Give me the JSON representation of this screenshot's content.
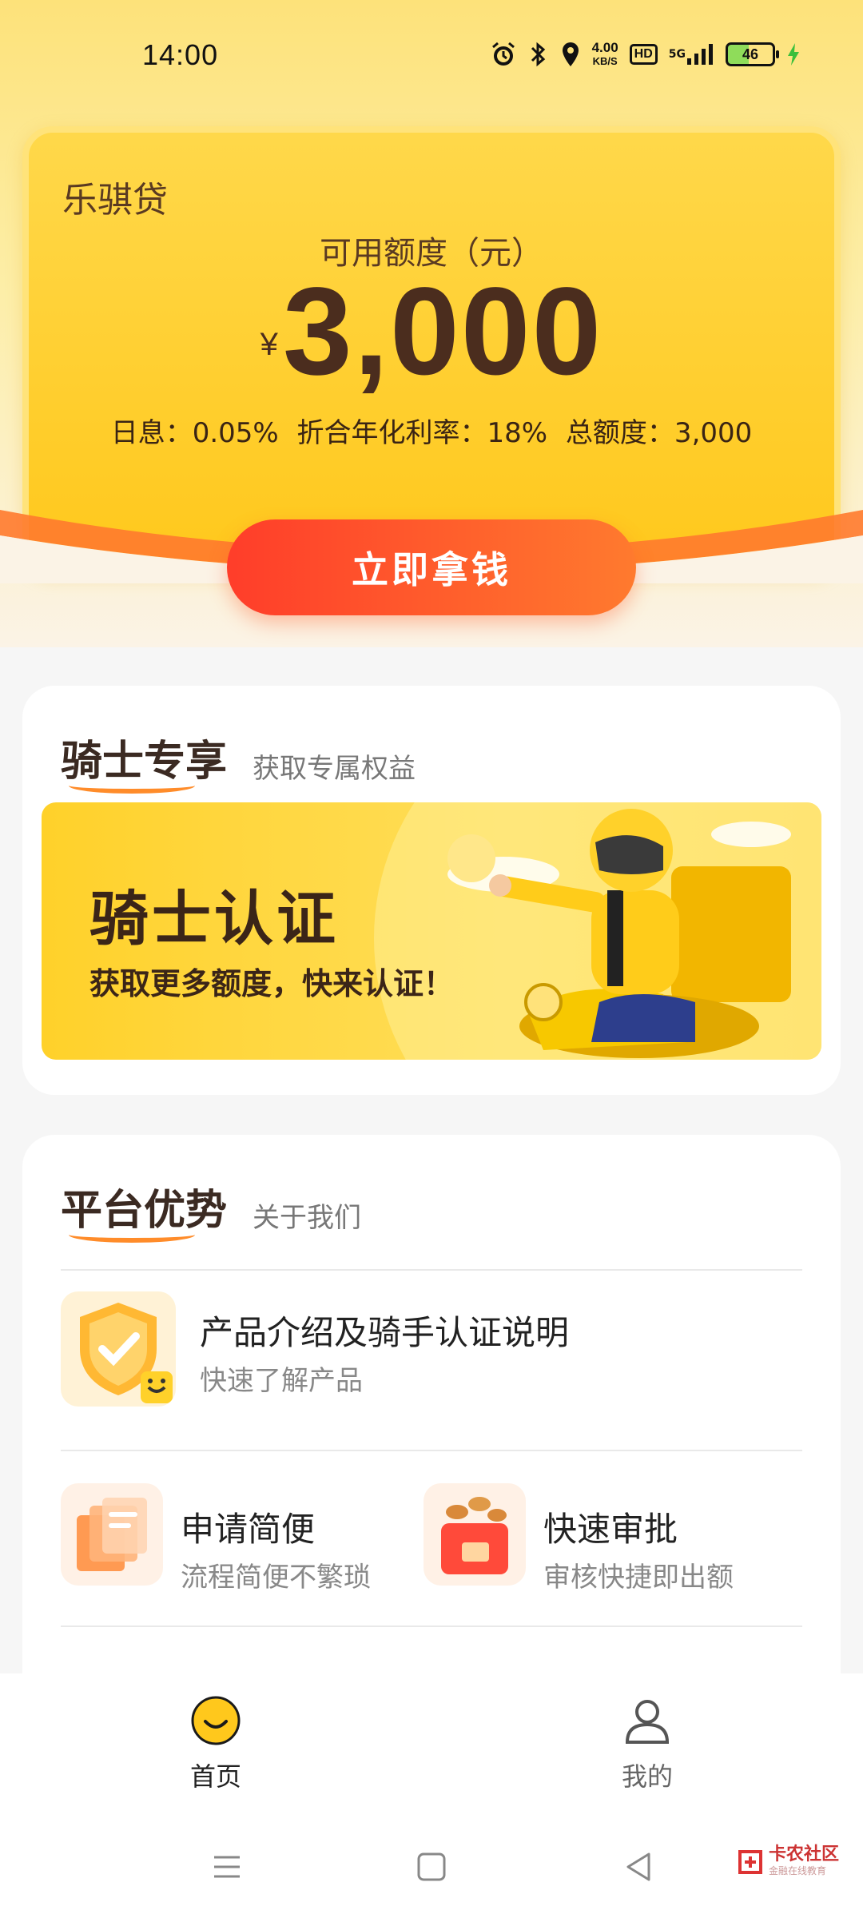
{
  "status_bar": {
    "time": "14:00",
    "speed_value": "4.00",
    "speed_unit": "KB/S",
    "hd": "HD",
    "network": "5G",
    "battery": "46",
    "icons": [
      "alarm-icon",
      "bluetooth-icon",
      "location-icon",
      "signal-icon",
      "charging-icon"
    ]
  },
  "credit": {
    "brand": "乐骐贷",
    "quota_label": "可用额度（元）",
    "currency": "¥",
    "amount": "3,000",
    "daily_rate": "日息：0.05%",
    "annual_rate": "折合年化利率：18%",
    "total_quota": "总额度：3,000",
    "cta": "立即拿钱"
  },
  "knight_section": {
    "title": "骑士专享",
    "subtitle": "获取专属权益",
    "banner_title": "骑士认证",
    "banner_subtitle": "获取更多额度，快来认证！"
  },
  "advantage_section": {
    "title": "平台优势",
    "subtitle": "关于我们",
    "items": [
      {
        "title": "产品介绍及骑手认证说明",
        "desc": "快速了解产品",
        "icon": "shield-check-icon"
      },
      {
        "title": "申请简便",
        "desc": "流程简便不繁琐",
        "icon": "documents-icon"
      },
      {
        "title": "快速审批",
        "desc": "审核快捷即出额",
        "icon": "coin-box-icon"
      }
    ]
  },
  "bottom_nav": {
    "items": [
      {
        "label": "首页",
        "icon": "smile-icon",
        "active": true
      },
      {
        "label": "我的",
        "icon": "user-icon",
        "active": false
      }
    ]
  },
  "watermark": {
    "text": "卡农社区",
    "sub": "金融在线教育"
  },
  "colors": {
    "accent_yellow": "#ffc81c",
    "cta_red": "#ff3d2a",
    "cta_orange": "#ff7a2e",
    "text_brown": "#4b2d1e"
  }
}
